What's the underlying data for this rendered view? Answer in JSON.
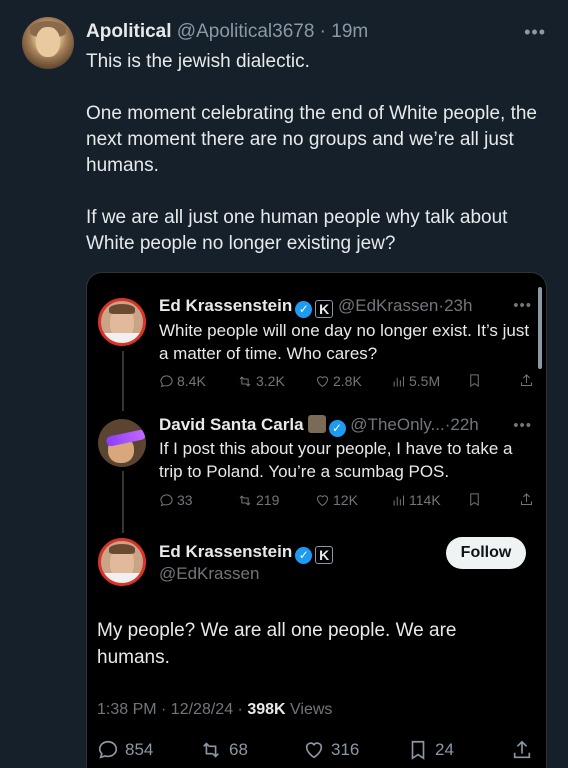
{
  "outer_tweet": {
    "display_name": "Apolitical",
    "handle": "@Apolitical3678",
    "time": "19m",
    "paragraphs": [
      "This is the jewish dialectic.",
      "One moment celebrating the end of White people, the next moment there are no groups and we’re all just humans.",
      "If we are all just one human people why talk about White people no longer existing jew?"
    ]
  },
  "quoted_thread": {
    "tweet1": {
      "display_name": "Ed Krassenstein",
      "handle": "@EdKrassen",
      "time": "23h",
      "text": "White people will one day no longer exist. It’s just a matter of time. Who cares?",
      "replies": "8.4K",
      "reposts": "3.2K",
      "likes": "2.8K",
      "views": "5.5M"
    },
    "tweet2": {
      "display_name": "David Santa Carla",
      "handle": "@TheOnly...",
      "time": "22h",
      "text": "If I post this about your people, I have to take a trip to Poland. You’re a scumbag POS.",
      "replies": "33",
      "reposts": "219",
      "likes": "12K",
      "views": "114K"
    },
    "main": {
      "display_name": "Ed Krassenstein",
      "handle": "@EdKrassen",
      "follow_label": "Follow",
      "text": "My people? We are all one people.  We are humans.",
      "timestamp": "1:38 PM · 12/28/24 · ",
      "views_count": "398K",
      "views_label": " Views",
      "replies": "854",
      "reposts": "68",
      "likes": "316",
      "bookmarks": "24"
    }
  },
  "badges": {
    "k_badge_letter": "K",
    "verified_check": "✓"
  },
  "colors": {
    "background": "#15202b",
    "card_background": "#000000",
    "accent_blue": "#1d9bf0",
    "muted_text": "#71767b"
  }
}
